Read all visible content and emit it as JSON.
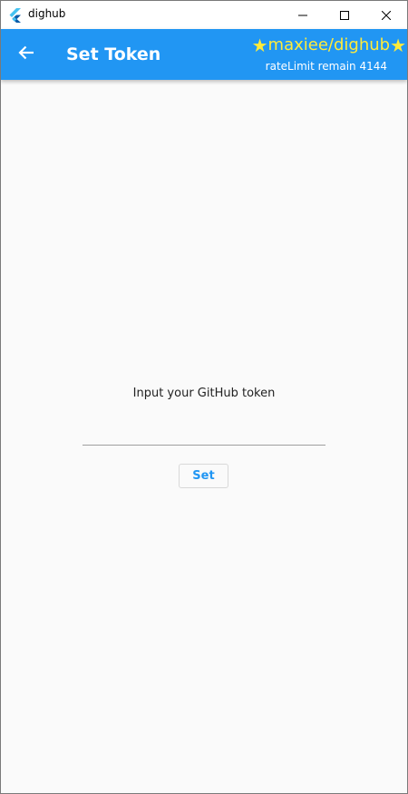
{
  "window": {
    "title": "dighub",
    "icon": "flutter-icon",
    "controls": [
      "minimize-icon",
      "maximize-icon",
      "close-icon"
    ]
  },
  "appbar": {
    "title": "Set Token",
    "back_icon": "arrow-left-icon",
    "repo_star_left": "★",
    "repo_name": "maxiee/dighub",
    "repo_star_right": "★",
    "rate_limit": "rateLimit remain 4144",
    "colors": {
      "background": "#2196f3",
      "repo": "#ffeb3b",
      "text": "#ffffff"
    }
  },
  "form": {
    "prompt": "Input your GitHub token",
    "token_value": "",
    "token_placeholder": "",
    "set_label": "Set"
  }
}
